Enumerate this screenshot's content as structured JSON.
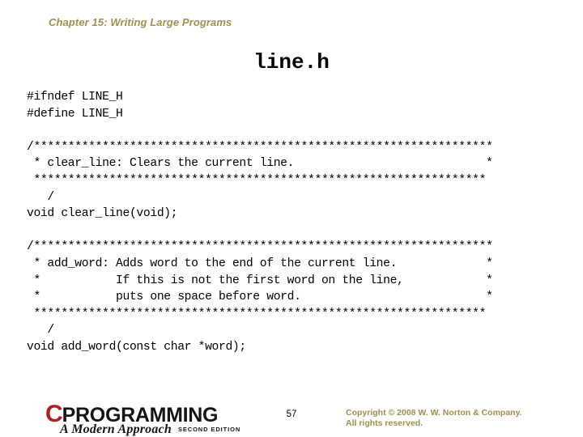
{
  "slide": {
    "chapter_header": "Chapter 15: Writing Large Programs",
    "title": "line.h",
    "page_number": "57",
    "accent_color": "#a09050",
    "logo_red": "#b01f24",
    "text_color": "#000000",
    "background": "#ffffff"
  },
  "code": {
    "language": "c",
    "lines": [
      "#ifndef LINE_H",
      "#define LINE_H",
      "",
      "/*******************************************************************",
      " * clear_line: Clears the current line.                            *",
      " ******************************************************************",
      "   /",
      "void clear_line(void);",
      "",
      "/*******************************************************************",
      " * add_word: Adds word to the end of the current line.             *",
      " *           If this is not the first word on the line,            *",
      " *           puts one space before word.                           *",
      " ******************************************************************",
      "   /",
      "void add_word(const char *word);"
    ]
  },
  "footer": {
    "logo_letter": "C",
    "logo_word": "PROGRAMMING",
    "logo_subtitle": "A Modern Approach",
    "logo_edition": "SECOND EDITION",
    "copyright_line1": "Copyright © 2008 W. W. Norton & Company.",
    "copyright_line2": "All rights reserved."
  }
}
